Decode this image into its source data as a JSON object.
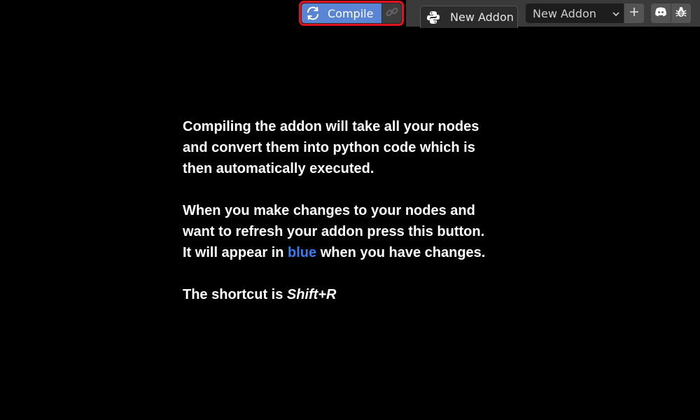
{
  "toolbar": {
    "compile_label": "Compile",
    "addon_tab_label": "New Addon",
    "addon_select_value": "New Addon",
    "compile_color": "#5a85d4",
    "highlight_color": "#e0141f"
  },
  "icons": {
    "compile": "refresh-icon",
    "link": "link-icon",
    "addon_tab": "python-icon",
    "dropdown": "chevron-down-icon",
    "add": "plus-icon",
    "discord": "discord-icon",
    "bug": "bug-icon"
  },
  "tooltip": {
    "para1_line1": "Compiling the addon will take all your nodes",
    "para1_line2": "and convert them into python code which is",
    "para1_line3": "then automatically executed.",
    "para2_line1": "When you make changes to your nodes and",
    "para2_line2": "want to refresh your addon press this button.",
    "para2_line3_before": "It will appear in ",
    "para2_line3_highlight": "blue",
    "para2_line3_after": " when you have changes.",
    "shortcut_prefix": "The shortcut is ",
    "shortcut_key": "Shift+R",
    "highlight_color": "#3b7bf0"
  }
}
